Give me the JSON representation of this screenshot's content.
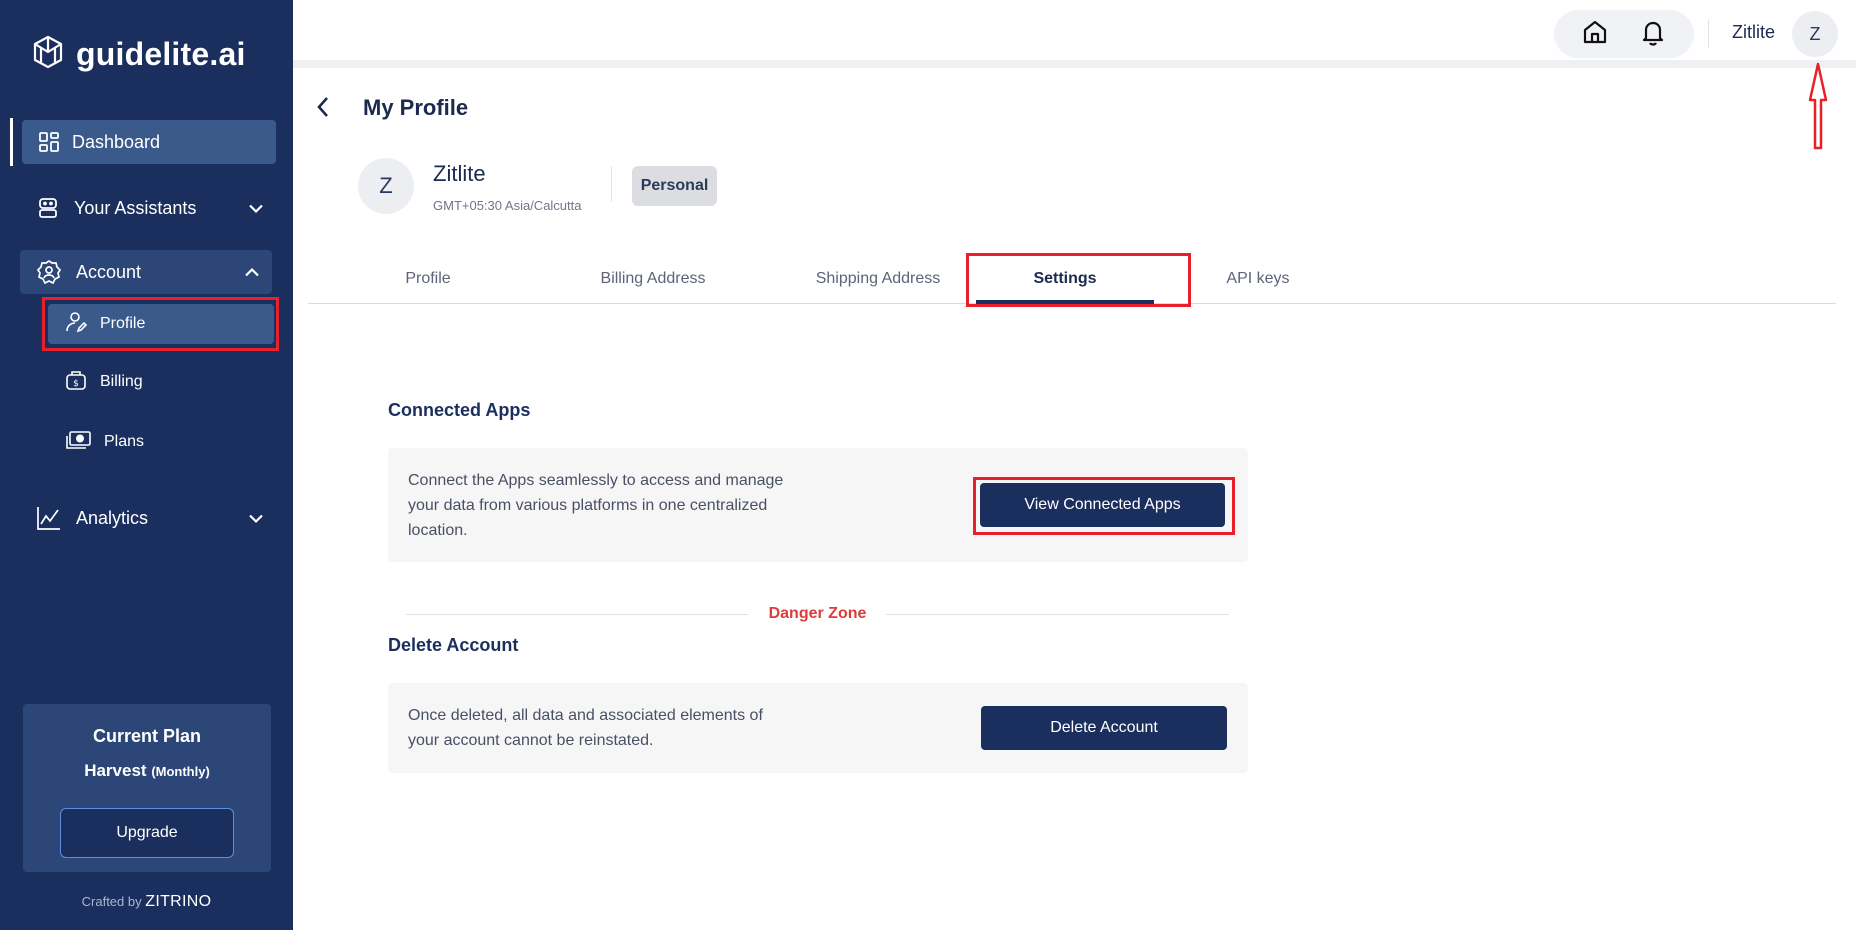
{
  "brand": {
    "name": "guidelite.ai"
  },
  "sidebar": {
    "dashboard": "Dashboard",
    "assistants": "Your Assistants",
    "account": "Account",
    "account_items": [
      {
        "label": "Profile",
        "icon": "user-edit-icon"
      },
      {
        "label": "Billing",
        "icon": "billing-bag-icon"
      },
      {
        "label": "Plans",
        "icon": "money-icon"
      }
    ],
    "analytics": "Analytics"
  },
  "plan": {
    "title": "Current Plan",
    "name": "Harvest",
    "period": "(Monthly)",
    "upgrade": "Upgrade"
  },
  "footer": {
    "crafted_by": "Crafted by",
    "company": "ZITRINO"
  },
  "topbar": {
    "user_name": "Zitlite",
    "avatar_initial": "Z"
  },
  "page": {
    "title": "My Profile"
  },
  "profile": {
    "avatar_initial": "Z",
    "name": "Zitlite",
    "timezone": "GMT+05:30 Asia/Calcutta",
    "badge": "Personal"
  },
  "tabs": [
    "Profile",
    "Billing Address",
    "Shipping Address",
    "Settings",
    "API keys"
  ],
  "active_tab": "Settings",
  "connected_apps": {
    "title": "Connected Apps",
    "line1": "Connect the Apps seamlessly to access and manage",
    "line2": "your data from various platforms in one centralized",
    "line3": "location.",
    "button": "View Connected Apps"
  },
  "danger_zone": {
    "label": "Danger Zone"
  },
  "delete_account": {
    "title": "Delete Account",
    "line1": "Once deleted, all data and associated elements of",
    "line2": "your account cannot be reinstated.",
    "button": "Delete Account"
  },
  "colors": {
    "sidebar_bg": "#1b2f5e",
    "active_bg": "#3b5a8c",
    "primary": "#1b2f5e",
    "danger": "#e03b3b",
    "annotation": "#e8202a"
  }
}
